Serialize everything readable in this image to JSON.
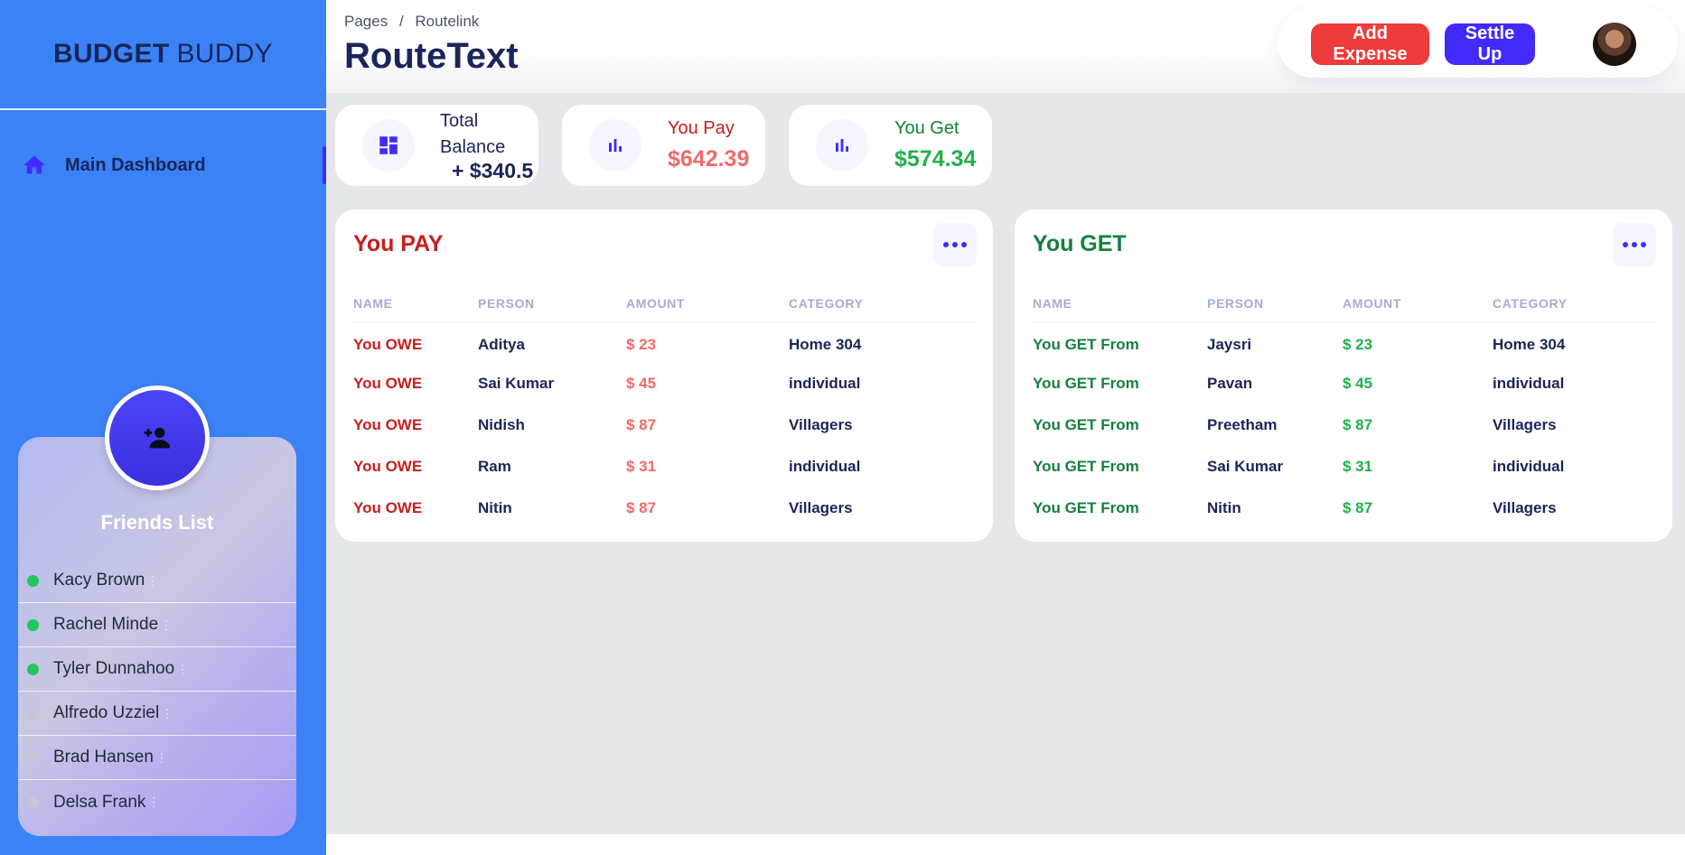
{
  "brand": {
    "bold": "BUDGET",
    "light": "BUDDY"
  },
  "nav": {
    "main_dashboard": "Main Dashboard"
  },
  "friends": {
    "title": "Friends List",
    "items": [
      {
        "name": "Kacy Brown",
        "status": "online"
      },
      {
        "name": "Rachel Minde",
        "status": "online"
      },
      {
        "name": "Tyler Dunnahoo",
        "status": "online"
      },
      {
        "name": "Alfredo Uzziel",
        "status": "offline"
      },
      {
        "name": "Brad Hansen",
        "status": "offline"
      },
      {
        "name": "Delsa Frank",
        "status": "offline"
      }
    ],
    "more_glyph": "⋮"
  },
  "header": {
    "breadcrumb": {
      "root": "Pages",
      "sep": "/",
      "current": "Routelink"
    },
    "title": "RouteText",
    "add_expense": "Add Expense",
    "settle_up": "Settle Up"
  },
  "stats": {
    "total": {
      "label": "Total Balance",
      "value": "+ $340.5"
    },
    "pay": {
      "label": "You Pay",
      "value": "$642.39"
    },
    "get": {
      "label": "You Get",
      "value": "$574.34"
    }
  },
  "pay_table": {
    "title": "You PAY",
    "columns": [
      "NAME",
      "PERSON",
      "AMOUNT",
      "CATEGORY"
    ],
    "rows": [
      [
        "You OWE",
        "Aditya",
        "$ 23",
        "Home 304"
      ],
      [
        "You OWE",
        "Sai Kumar",
        "$ 45",
        "individual"
      ],
      [
        "You OWE",
        "Nidish",
        "$ 87",
        "Villagers"
      ],
      [
        "You OWE",
        "Ram",
        "$ 31",
        "individual"
      ],
      [
        "You OWE",
        "Nitin",
        "$ 87",
        "Villagers"
      ]
    ]
  },
  "get_table": {
    "title": "You GET",
    "columns": [
      "NAME",
      "PERSON",
      "AMOUNT",
      "CATEGORY"
    ],
    "rows": [
      [
        "You GET From",
        "Jaysri",
        "$ 23",
        "Home 304"
      ],
      [
        "You GET From",
        "Pavan",
        "$ 45",
        "individual"
      ],
      [
        "You GET From",
        "Preetham",
        "$ 87",
        "Villagers"
      ],
      [
        "You GET From",
        "Sai Kumar",
        "$ 31",
        "individual"
      ],
      [
        "You GET From",
        "Nitin",
        "$ 87",
        "Villagers"
      ]
    ]
  },
  "colors": {
    "sidebar": "#3b82f6",
    "brand_text": "#1b2559",
    "accent": "#422afb",
    "danger": "#ef3b3b",
    "pay_text": "#c81e1e",
    "get_text": "#15803d"
  }
}
